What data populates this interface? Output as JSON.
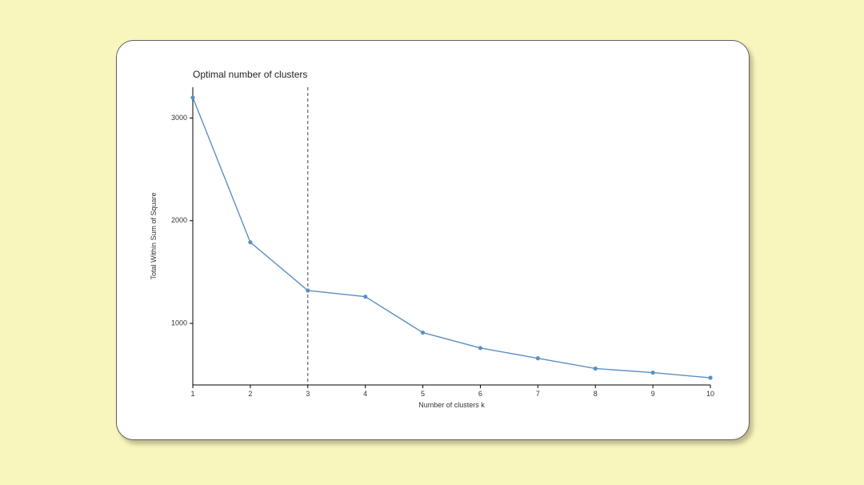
{
  "chart_data": {
    "type": "line",
    "title": "Optimal number of clusters",
    "xlabel": "Number of clusters k",
    "ylabel": "Total Within Sum of Square",
    "x": [
      1,
      2,
      3,
      4,
      5,
      6,
      7,
      8,
      9,
      10
    ],
    "values": [
      3200,
      1790,
      1320,
      1260,
      910,
      760,
      660,
      560,
      520,
      470
    ],
    "reference_x": 3,
    "xlim": [
      1,
      10
    ],
    "ylim": [
      400,
      3300
    ],
    "y_ticks": [
      1000,
      2000,
      3000
    ],
    "x_ticks": [
      1,
      2,
      3,
      4,
      5,
      6,
      7,
      8,
      9,
      10
    ]
  }
}
